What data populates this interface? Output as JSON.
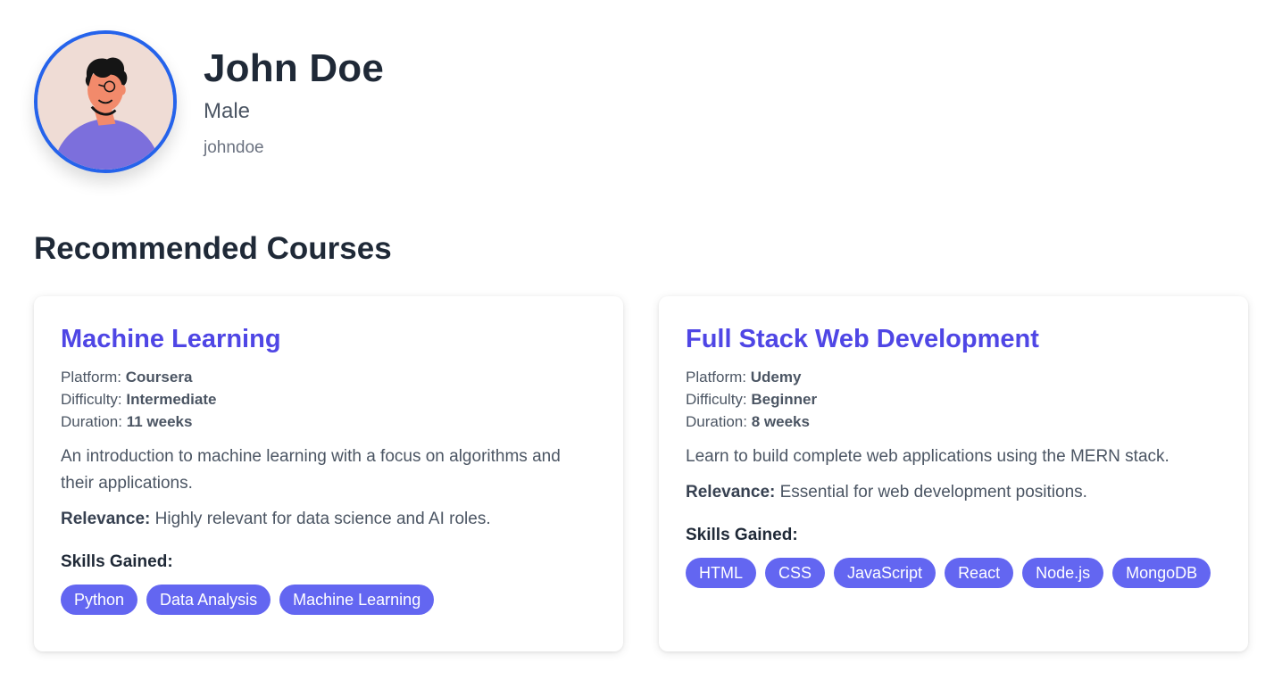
{
  "profile": {
    "name": "John Doe",
    "gender": "Male",
    "username": "johndoe",
    "avatar_icon": "person-avatar-illustration"
  },
  "section_title": "Recommended Courses",
  "labels": {
    "platform": "Platform:",
    "difficulty": "Difficulty:",
    "duration": "Duration:",
    "relevance": "Relevance:",
    "skills_gained": "Skills Gained:"
  },
  "courses": [
    {
      "title": "Machine Learning",
      "platform": "Coursera",
      "difficulty": "Intermediate",
      "duration": "11 weeks",
      "description": "An introduction to machine learning with a focus on algorithms and their applications.",
      "relevance": "Highly relevant for data science and AI roles.",
      "skills": [
        "Python",
        "Data Analysis",
        "Machine Learning"
      ]
    },
    {
      "title": "Full Stack Web Development",
      "platform": "Udemy",
      "difficulty": "Beginner",
      "duration": "8 weeks",
      "description": "Learn to build complete web applications using the MERN stack.",
      "relevance": "Essential for web development positions.",
      "skills": [
        "HTML",
        "CSS",
        "JavaScript",
        "React",
        "Node.js",
        "MongoDB"
      ]
    }
  ],
  "colors": {
    "accent": "#4f46e5",
    "pill": "#6366f1",
    "avatar_border": "#2563eb",
    "heading": "#1f2937"
  }
}
